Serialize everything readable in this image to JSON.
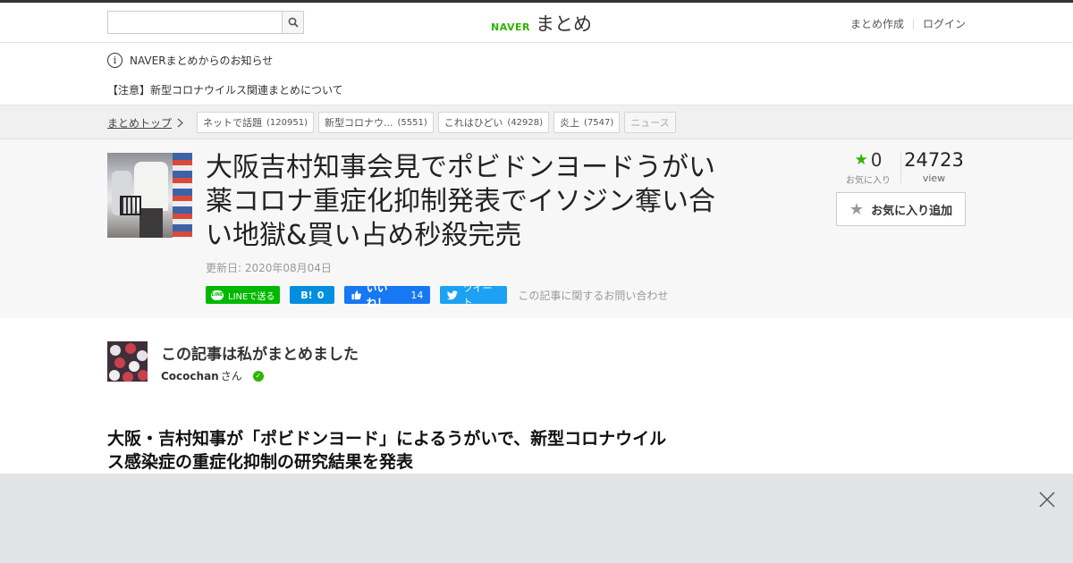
{
  "header": {
    "search_placeholder": "",
    "logo_brand": "NAVER",
    "logo_service": "まとめ",
    "links": [
      "まとめ作成",
      "ログイン"
    ]
  },
  "notice": {
    "title": "NAVERまとめからのお知らせ",
    "item": "【注意】新型コロナウイルス関連まとめについて"
  },
  "breadcrumb": {
    "home": "まとめトップ",
    "tags": [
      {
        "label": "ネットで話題",
        "count": "(120951)"
      },
      {
        "label": "新型コロナウ...",
        "count": "(5551)"
      },
      {
        "label": "これはひどい",
        "count": "(42928)"
      },
      {
        "label": "炎上",
        "count": "(7547)"
      },
      {
        "label": "ニュース",
        "count": ""
      }
    ]
  },
  "article": {
    "title": "大阪吉村知事会見でポビドンヨードうがい薬コロナ重症化抑制発表でイソジン奪い合い地獄&買い占め秒殺完売",
    "updated": "更新日: 2020年08月04日",
    "share": {
      "line": "LINEで送る",
      "hatena_label": "B!",
      "hatena_count": "0",
      "fb_label": "いいね！",
      "fb_count": "14",
      "tweet": "ツイート",
      "contact": "この記事に関するお問い合わせ"
    },
    "stats": {
      "fav_count": "0",
      "fav_label": "お気に入り",
      "view_count": "24723",
      "view_label": "view"
    },
    "fav_button": "お気に入り追加"
  },
  "author": {
    "heading": "この記事は私がまとめました",
    "name": "Cocochan",
    "suffix": "さん"
  },
  "content": {
    "headline": "大阪・吉村知事が「ポビドンヨード」によるうがいで、新型コロナウイルス感染症の重症化抑制の研究結果を発表"
  },
  "colors": {
    "brand_green": "#2db400",
    "line_green": "#00b900",
    "hatena_blue": "#008fde",
    "facebook_blue": "#1877f2",
    "twitter_blue": "#1da1f2"
  }
}
